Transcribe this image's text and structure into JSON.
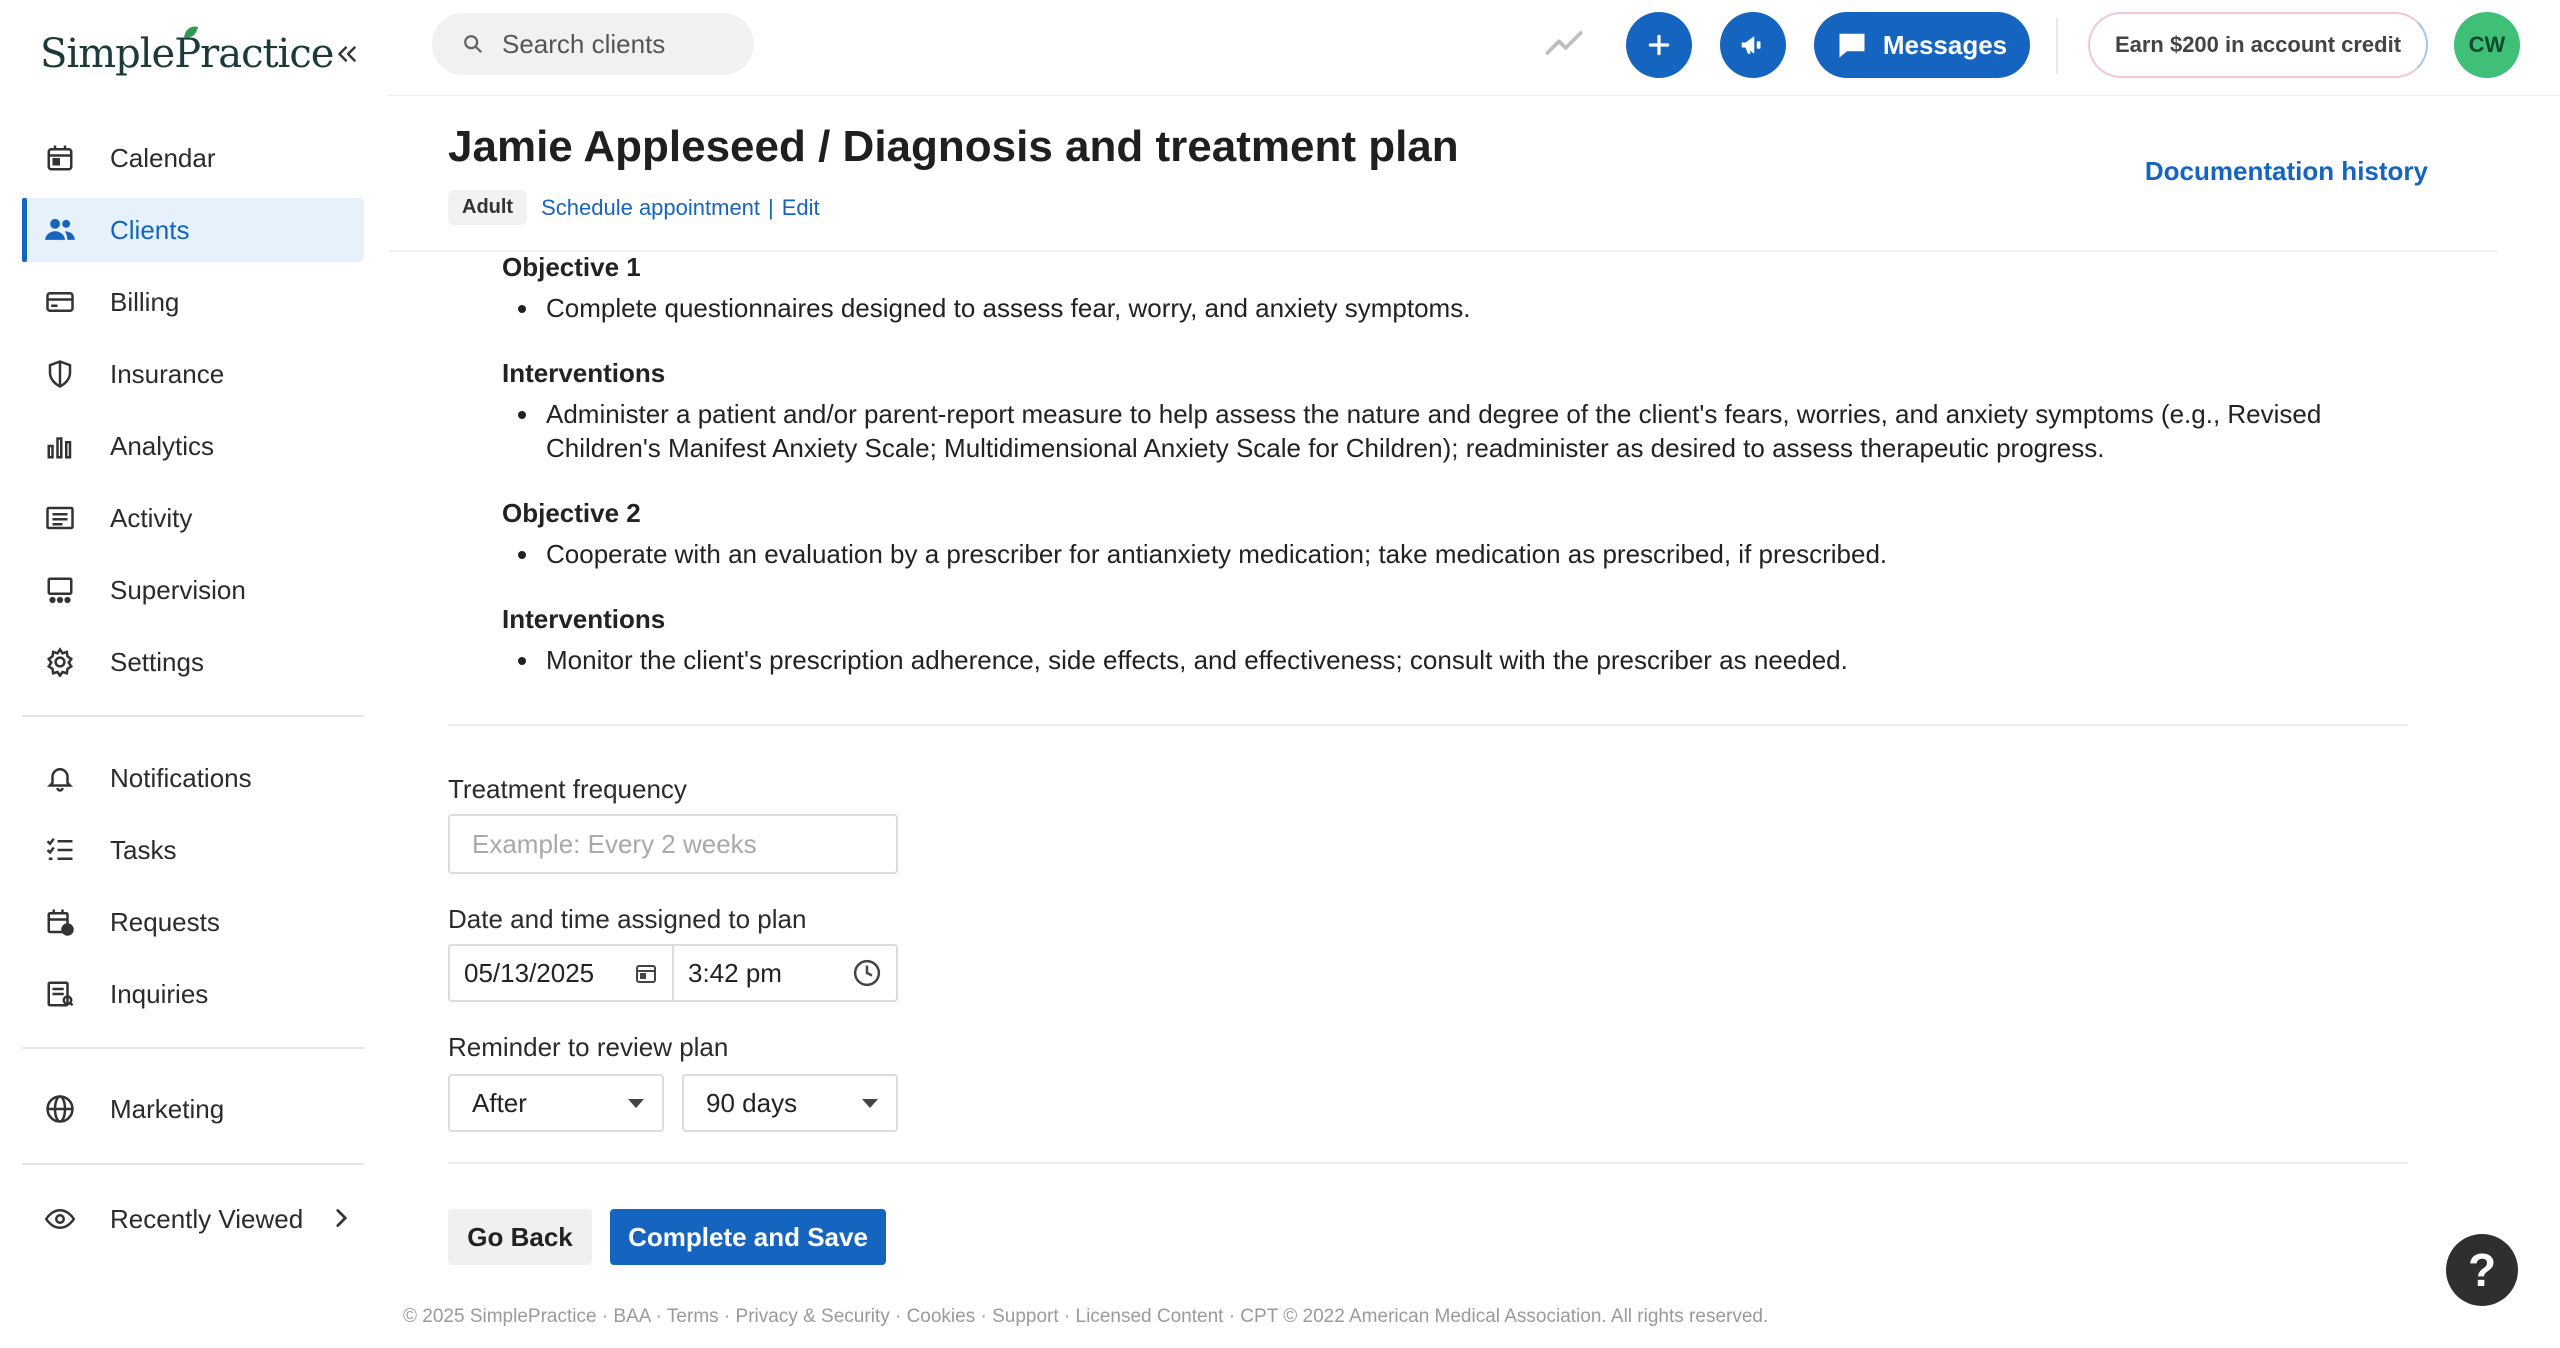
{
  "app": {
    "logo_text": "SimplePractice"
  },
  "sidebar": {
    "items": [
      {
        "label": "Calendar",
        "icon": "calendar-icon"
      },
      {
        "label": "Clients",
        "icon": "clients-icon",
        "active": true
      },
      {
        "label": "Billing",
        "icon": "billing-icon"
      },
      {
        "label": "Insurance",
        "icon": "shield-icon"
      },
      {
        "label": "Analytics",
        "icon": "analytics-icon"
      },
      {
        "label": "Activity",
        "icon": "activity-icon"
      },
      {
        "label": "Supervision",
        "icon": "supervision-icon"
      },
      {
        "label": "Settings",
        "icon": "gear-icon"
      },
      {
        "label": "Notifications",
        "icon": "bell-icon"
      },
      {
        "label": "Tasks",
        "icon": "tasks-icon"
      },
      {
        "label": "Requests",
        "icon": "requests-icon"
      },
      {
        "label": "Inquiries",
        "icon": "inquiries-icon"
      },
      {
        "label": "Marketing",
        "icon": "globe-icon"
      },
      {
        "label": "Recently Viewed",
        "icon": "eye-icon"
      }
    ]
  },
  "topbar": {
    "search_placeholder": "Search clients",
    "messages_label": "Messages",
    "earn_label": "Earn $200 in account credit",
    "avatar_initials": "CW"
  },
  "header": {
    "title": "Jamie Appleseed / Diagnosis and treatment plan",
    "badge": "Adult",
    "schedule_link": "Schedule appointment",
    "separator": "|",
    "edit_link": "Edit",
    "documentation_history": "Documentation history"
  },
  "plan": {
    "objective1_title": "Objective 1",
    "objective1_text": "Complete questionnaires designed to assess fear, worry, and anxiety symptoms.",
    "interventions1_title": "Interventions",
    "interventions1_text": "Administer a patient and/or parent-report measure to help assess the nature and degree of the client's fears, worries, and anxiety symptoms (e.g., Revised Children's Manifest Anxiety Scale; Multidimensional Anxiety Scale for Children); readminister as desired to assess therapeutic progress.",
    "objective2_title": "Objective 2",
    "objective2_text": "Cooperate with an evaluation by a prescriber for antianxiety medication; take medication as prescribed, if prescribed.",
    "interventions2_title": "Interventions",
    "interventions2_text": "Monitor the client's prescription adherence, side effects, and effectiveness; consult with the prescriber as needed."
  },
  "form": {
    "frequency_label": "Treatment frequency",
    "frequency_placeholder": "Example: Every 2 weeks",
    "datetime_label": "Date and time assigned to plan",
    "date_value": "05/13/2025",
    "time_value": "3:42 pm",
    "reminder_label": "Reminder to review plan",
    "reminder_when": "After",
    "reminder_period": "90 days",
    "go_back": "Go Back",
    "complete_save": "Complete and Save"
  },
  "footer": {
    "text": "© 2025 SimplePractice · BAA · Terms · Privacy & Security · Cookies · Support · Licensed Content · CPT © 2022 American Medical Association. All rights reserved."
  },
  "help": {
    "label": "?"
  },
  "colors": {
    "accent": "#1565c0",
    "active_bg": "#e6f1fb",
    "avatar": "#3fbf78"
  }
}
